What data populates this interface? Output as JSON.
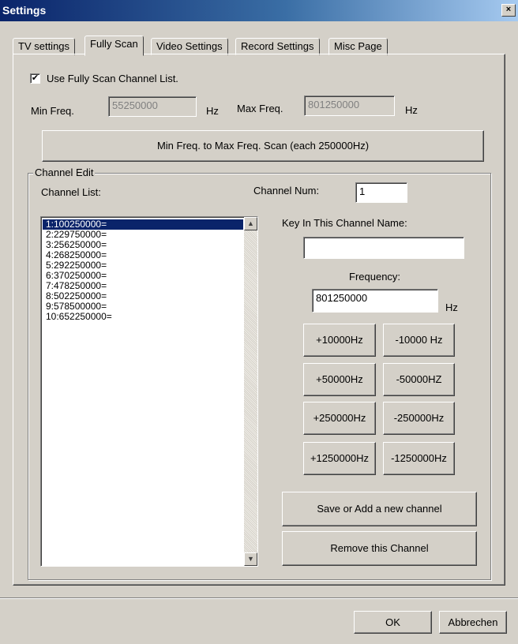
{
  "window": {
    "title": "Settings",
    "close_glyph": "×"
  },
  "tabs": [
    {
      "label": "TV settings"
    },
    {
      "label": "Fully Scan"
    },
    {
      "label": "Video Settings"
    },
    {
      "label": "Record Settings"
    },
    {
      "label": "Misc Page"
    }
  ],
  "active_tab": "Fully Scan",
  "fully_scan": {
    "use_list_label": "Use Fully Scan Channel List.",
    "use_list_checked": true,
    "check_glyph": "✔",
    "min_freq_label": "Min Freq.",
    "min_freq_value": "55250000",
    "max_freq_label": "Max Freq.",
    "max_freq_value": "801250000",
    "hz_unit": "Hz",
    "scan_button": "Min Freq. to Max Freq. Scan (each 250000Hz)"
  },
  "channel_edit": {
    "group_label": "Channel Edit",
    "channel_list_label": "Channel List:",
    "channel_num_label": "Channel Num:",
    "channel_num_value": "1",
    "channels": [
      "1:100250000=",
      "2:229750000=",
      "3:256250000=",
      "4:268250000=",
      "5:292250000=",
      "6:370250000=",
      "7:478250000=",
      "8:502250000=",
      "9:578500000=",
      "10:652250000="
    ],
    "selected_index": 0,
    "key_in_name_label": "Key In This Channel Name:",
    "channel_name_value": "",
    "frequency_label": "Frequency:",
    "frequency_value": "801250000",
    "hz_unit": "Hz",
    "step_buttons": {
      "plus_10000": "+10000Hz",
      "minus_10000": "-10000 Hz",
      "plus_50000": "+50000Hz",
      "minus_50000": "-50000HZ",
      "plus_250000": "+250000Hz",
      "minus_250000": "-250000Hz",
      "plus_1250000": "+1250000Hz",
      "minus_1250000": "-1250000Hz"
    },
    "save_button": "Save or Add a new channel",
    "remove_button": "Remove this Channel"
  },
  "footer": {
    "ok_button": "OK",
    "cancel_button": "Abbrechen"
  }
}
